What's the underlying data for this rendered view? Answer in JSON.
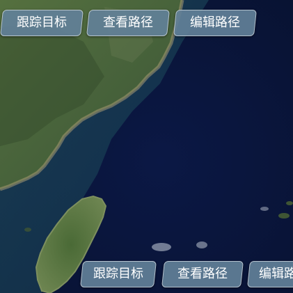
{
  "map": {
    "colors": {
      "ocean_deep": "#0a1538",
      "ocean_shallow": "#1a3a5a",
      "land_green": "#4d6a3a",
      "land_dark": "#33492a",
      "coast_tan": "#a89a72",
      "island_green": "#5d7a44"
    }
  },
  "top_toolbar": {
    "track_label": "跟踪目标",
    "view_path_label": "查看路径",
    "edit_path_label": "编辑路径"
  },
  "bottom_toolbar": {
    "track_label": "跟踪目标",
    "view_path_label": "查看路径",
    "edit_path_label": "编辑路径"
  }
}
